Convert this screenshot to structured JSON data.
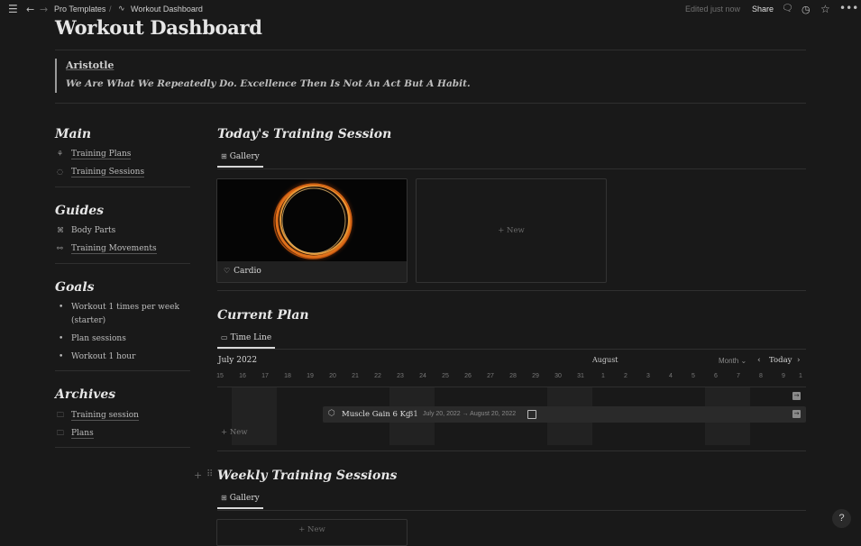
{
  "topbar": {
    "breadcrumb_parent": "Pro Templates",
    "breadcrumb_sep": "/",
    "breadcrumb_current": "Workout Dashboard",
    "edited": "Edited just now",
    "share": "Share"
  },
  "page": {
    "title": "Workout Dashboard"
  },
  "quote": {
    "author": "Aristotle",
    "text": "We Are What We Repeatedly Do. Excellence Then Is Not An Act But A Habit."
  },
  "sidebar": {
    "main": {
      "heading": "Main",
      "items": [
        "Training Plans",
        "Training Sessions"
      ]
    },
    "guides": {
      "heading": "Guides",
      "items": [
        "Body Parts",
        "Training Movements"
      ]
    },
    "goals": {
      "heading": "Goals",
      "items": [
        "Workout 1 times per week",
        "(starter)",
        "Plan sessions",
        "Workout 1 hour"
      ]
    },
    "archives": {
      "heading": "Archives",
      "items": [
        "Training session",
        "Plans"
      ]
    }
  },
  "today_session": {
    "heading": "Today's Training Session",
    "view_tab": "Gallery",
    "card_title": "Cardio",
    "new_label": "+ New"
  },
  "current_plan": {
    "heading": "Current Plan",
    "view_tab": "Time Line",
    "month_left": "July 2022",
    "month_mid": "August",
    "scale": "Month",
    "today": "Today",
    "days": [
      "15",
      "16",
      "17",
      "18",
      "19",
      "20",
      "21",
      "22",
      "23",
      "24",
      "25",
      "26",
      "27",
      "28",
      "29",
      "30",
      "31",
      "1",
      "2",
      "3",
      "4",
      "5",
      "6",
      "7",
      "8",
      "9",
      "1"
    ],
    "item_name": "Muscle Gain 6 Kg",
    "item_number": "31",
    "item_dates": "July 20, 2022 → August 20, 2022",
    "new_label": "+ New"
  },
  "weekly": {
    "heading": "Weekly Training Sessions",
    "view_tab": "Gallery",
    "new_label": "+ New"
  },
  "help": "?",
  "colors": {
    "background": "#191919",
    "ring": "#f08a24"
  }
}
